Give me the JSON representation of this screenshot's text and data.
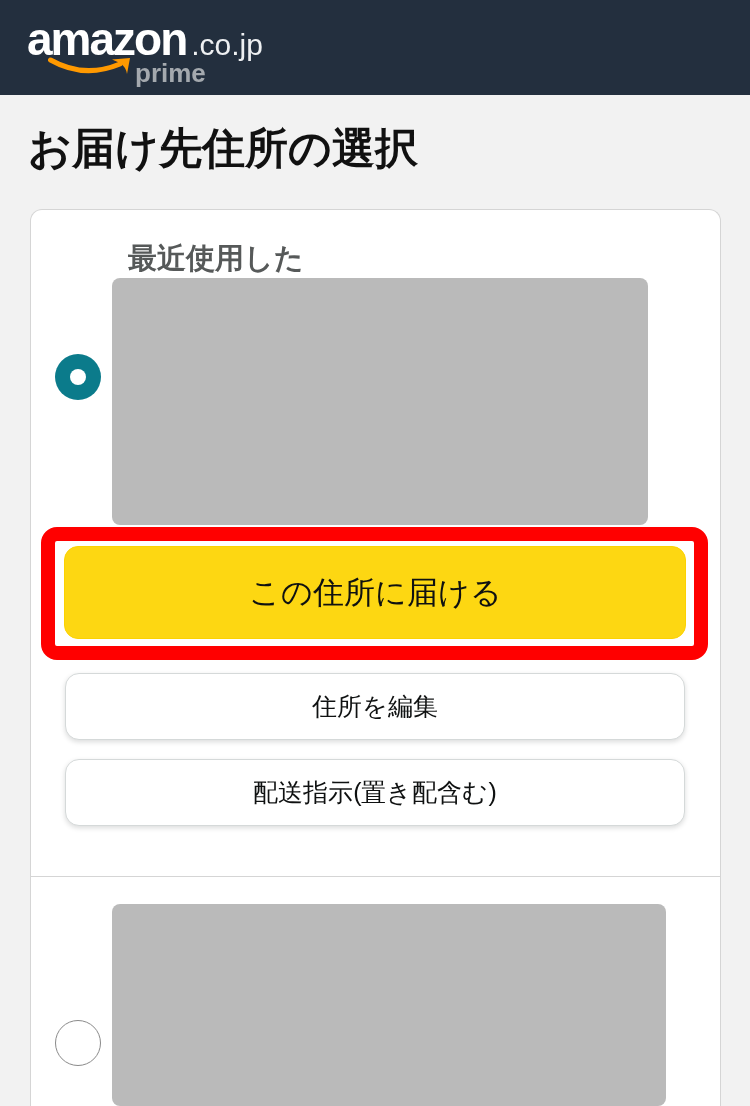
{
  "header": {
    "logo": {
      "wordmark": "amazon",
      "domain": ".co.jp",
      "badge": "prime"
    }
  },
  "page_title": "お届け先住所の選択",
  "addresses": [
    {
      "selected": true,
      "tag": "最近使用した",
      "actions": [
        {
          "kind": "primary",
          "label": "この住所に届ける",
          "highlighted": true
        },
        {
          "kind": "secondary",
          "label": "住所を編集",
          "highlighted": false
        },
        {
          "kind": "secondary",
          "label": "配送指示(置き配含む)",
          "highlighted": false
        }
      ]
    },
    {
      "selected": false
    }
  ]
}
